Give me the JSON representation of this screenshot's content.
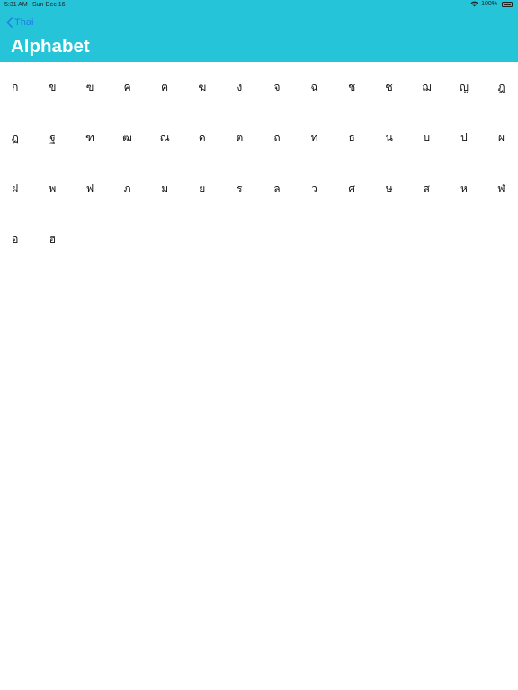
{
  "status_bar": {
    "time": "5:31 AM",
    "date": "Sun Dec 16",
    "battery": "100%",
    "battery_level": 1.0
  },
  "nav": {
    "back_label": "Thai",
    "title": "Alphabet"
  },
  "colors": {
    "header_bg": "#26c4d9",
    "back_tint": "#1a7fe6",
    "title_text": "#ffffff"
  },
  "letters": [
    "ก",
    "ข",
    "ฃ",
    "ค",
    "ฅ",
    "ฆ",
    "ง",
    "จ",
    "ฉ",
    "ช",
    "ซ",
    "ฌ",
    "ญ",
    "ฎ",
    "ฏ",
    "ฐ",
    "ฑ",
    "ฒ",
    "ณ",
    "ด",
    "ต",
    "ถ",
    "ท",
    "ธ",
    "น",
    "บ",
    "ป",
    "ผ",
    "ฝ",
    "พ",
    "ฟ",
    "ภ",
    "ม",
    "ย",
    "ร",
    "ล",
    "ว",
    "ศ",
    "ษ",
    "ส",
    "ห",
    "ฬ",
    "อ",
    "ฮ"
  ]
}
